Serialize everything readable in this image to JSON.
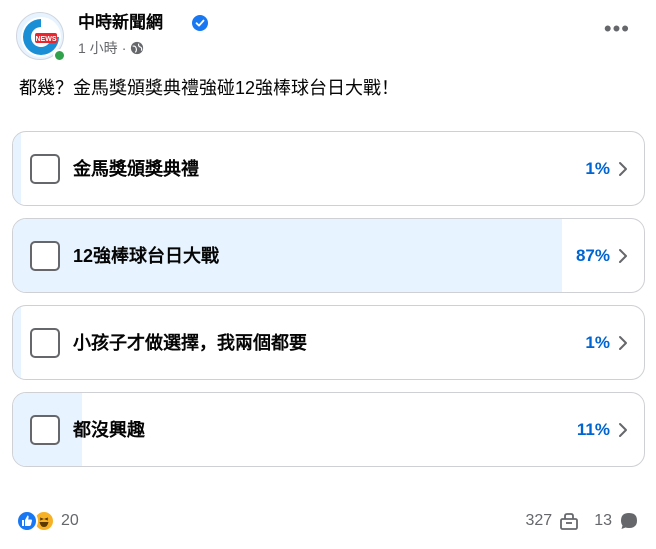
{
  "post": {
    "page_name": "中時新聞網",
    "time": "1 小時",
    "separator": "·",
    "text": "都幾？金馬獎頒獎典禮強碰12強棒球台日大戰！",
    "more": "•••"
  },
  "poll": {
    "options": [
      {
        "label": "金馬獎頒獎典禮",
        "percent_text": "1%",
        "fraction": 0.01
      },
      {
        "label": "12強棒球台日大戰",
        "percent_text": "87%",
        "fraction": 0.87
      },
      {
        "label": "小孩子才做選擇，我兩個都要",
        "percent_text": "1%",
        "fraction": 0.01
      },
      {
        "label": "都沒興趣",
        "percent_text": "11%",
        "fraction": 0.11
      }
    ]
  },
  "footer": {
    "reaction_count": "20",
    "share_count": "327",
    "comment_count": "13"
  },
  "icons": {
    "verified": "verified-badge-icon",
    "globe": "globe-icon",
    "share": "share-icon",
    "comment": "comment-icon"
  },
  "colors": {
    "accent": "#0064d1",
    "fill": "#e7f3ff",
    "like": "#1877f2",
    "haha": "#f7b125"
  }
}
